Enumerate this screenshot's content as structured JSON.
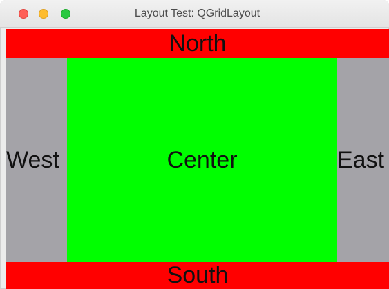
{
  "window": {
    "title": "Layout Test: QGridLayout",
    "controls": {
      "close_color": "#fe5f57",
      "minimize_color": "#febc2e",
      "zoom_color": "#28c840"
    }
  },
  "layout": {
    "north": {
      "label": "North",
      "color": "#ff0000"
    },
    "west": {
      "label": "West",
      "color": "#a4a3a8"
    },
    "center": {
      "label": "Center",
      "color": "#00ff00"
    },
    "east": {
      "label": "East",
      "color": "#a4a3a8"
    },
    "south": {
      "label": "South",
      "color": "#ff0000"
    }
  }
}
